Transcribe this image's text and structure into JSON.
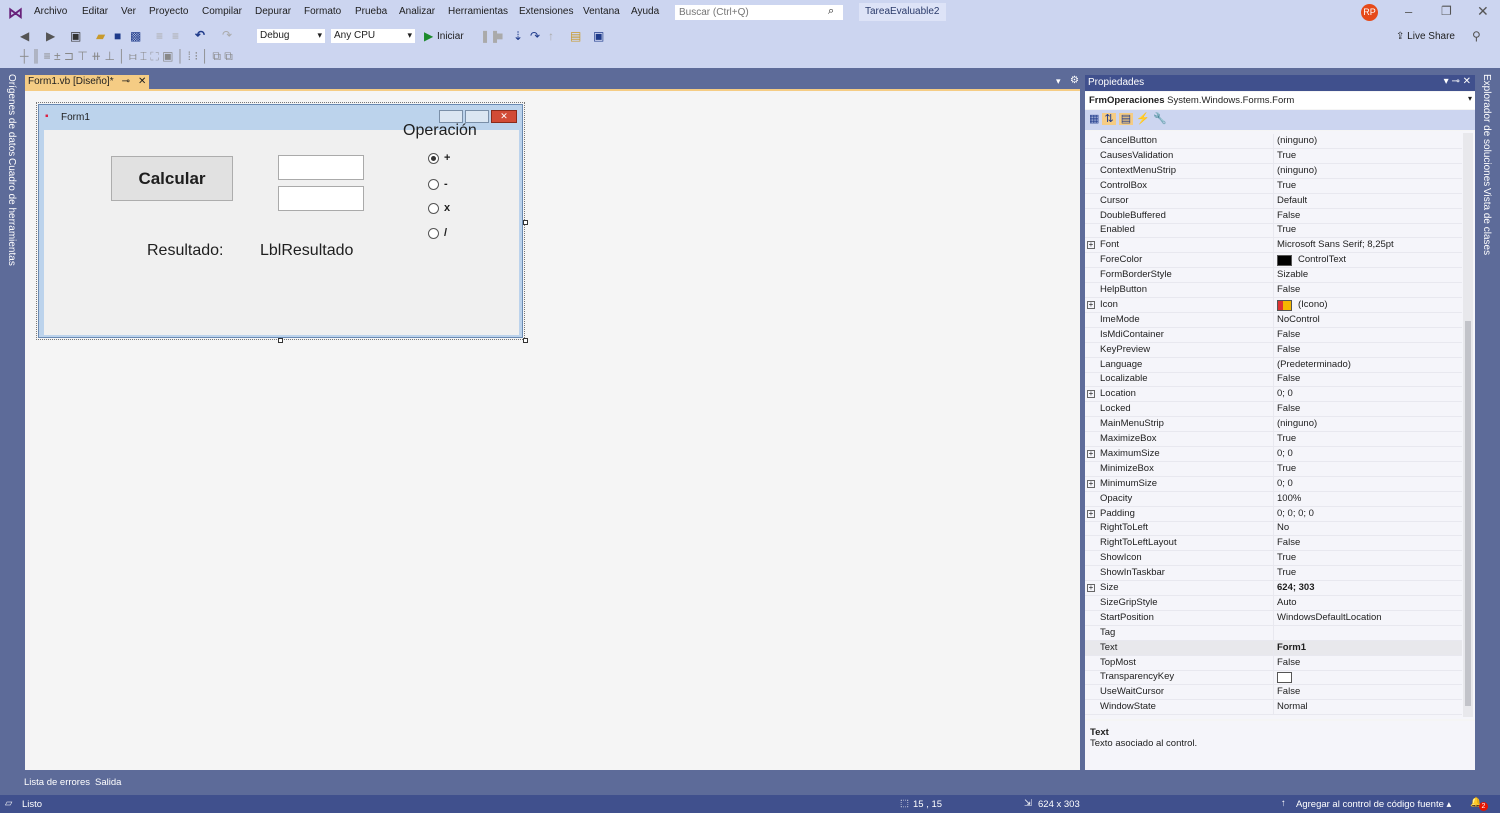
{
  "menu": [
    "Archivo",
    "Editar",
    "Ver",
    "Proyecto",
    "Compilar",
    "Depurar",
    "Formato",
    "Prueba",
    "Analizar",
    "Herramientas",
    "Extensiones",
    "Ventana",
    "Ayuda"
  ],
  "search": {
    "placeholder": "Buscar (Ctrl+Q)"
  },
  "solution_name": "TareaEvaluable2",
  "user_initials": "RP",
  "live_share": "Live Share",
  "toolbar": {
    "config": "Debug",
    "platform": "Any CPU",
    "start": "Iniciar"
  },
  "left_tabs": [
    "Orígenes de datos",
    "Cuadro de herramientas"
  ],
  "right_tabs": [
    "Explorador de soluciones",
    "Vista de clases"
  ],
  "doc_tab": "Form1.vb [Diseño]*",
  "form": {
    "title": "Form1",
    "button": "Calcular",
    "group_label": "Operación",
    "radios": [
      {
        "label": "+",
        "checked": true
      },
      {
        "label": "-",
        "checked": false
      },
      {
        "label": "x",
        "checked": false
      },
      {
        "label": "/",
        "checked": false
      }
    ],
    "result_label": "Resultado:",
    "result_value": "LblResultado"
  },
  "properties": {
    "title": "Propiedades",
    "object_name": "FrmOperaciones",
    "object_type": "System.Windows.Forms.Form",
    "rows": [
      {
        "name": "CancelButton",
        "value": "(ninguno)"
      },
      {
        "name": "CausesValidation",
        "value": "True"
      },
      {
        "name": "ContextMenuStrip",
        "value": "(ninguno)"
      },
      {
        "name": "ControlBox",
        "value": "True"
      },
      {
        "name": "Cursor",
        "value": "Default"
      },
      {
        "name": "DoubleBuffered",
        "value": "False"
      },
      {
        "name": "Enabled",
        "value": "True"
      },
      {
        "name": "Font",
        "value": "Microsoft Sans Serif; 8,25pt",
        "expand": true
      },
      {
        "name": "ForeColor",
        "value": "ControlText",
        "swatch": "#000000"
      },
      {
        "name": "FormBorderStyle",
        "value": "Sizable"
      },
      {
        "name": "HelpButton",
        "value": "False"
      },
      {
        "name": "Icon",
        "value": "(Icono)",
        "expand": true,
        "icon": true
      },
      {
        "name": "ImeMode",
        "value": "NoControl"
      },
      {
        "name": "IsMdiContainer",
        "value": "False"
      },
      {
        "name": "KeyPreview",
        "value": "False"
      },
      {
        "name": "Language",
        "value": "(Predeterminado)"
      },
      {
        "name": "Localizable",
        "value": "False"
      },
      {
        "name": "Location",
        "value": "0; 0",
        "expand": true
      },
      {
        "name": "Locked",
        "value": "False"
      },
      {
        "name": "MainMenuStrip",
        "value": "(ninguno)"
      },
      {
        "name": "MaximizeBox",
        "value": "True"
      },
      {
        "name": "MaximumSize",
        "value": "0; 0",
        "expand": true
      },
      {
        "name": "MinimizeBox",
        "value": "True"
      },
      {
        "name": "MinimumSize",
        "value": "0; 0",
        "expand": true
      },
      {
        "name": "Opacity",
        "value": "100%"
      },
      {
        "name": "Padding",
        "value": "0; 0; 0; 0",
        "expand": true
      },
      {
        "name": "RightToLeft",
        "value": "No"
      },
      {
        "name": "RightToLeftLayout",
        "value": "False"
      },
      {
        "name": "ShowIcon",
        "value": "True"
      },
      {
        "name": "ShowInTaskbar",
        "value": "True"
      },
      {
        "name": "Size",
        "value": "624; 303",
        "expand": true,
        "bold": true
      },
      {
        "name": "SizeGripStyle",
        "value": "Auto"
      },
      {
        "name": "StartPosition",
        "value": "WindowsDefaultLocation"
      },
      {
        "name": "Tag",
        "value": ""
      },
      {
        "name": "Text",
        "value": "Form1",
        "bold": true,
        "selected": true
      },
      {
        "name": "TopMost",
        "value": "False"
      },
      {
        "name": "TransparencyKey",
        "value": "",
        "swatch": "#ffffff"
      },
      {
        "name": "UseWaitCursor",
        "value": "False"
      },
      {
        "name": "WindowState",
        "value": "Normal"
      }
    ],
    "desc_title": "Text",
    "desc_text": "Texto asociado al control."
  },
  "bottom_tabs": [
    "Lista de errores",
    "Salida"
  ],
  "status": {
    "ready": "Listo",
    "position": "15 , 15",
    "size": "624 x 303",
    "source_control": "Agregar al control de código fuente",
    "notifications": "2"
  },
  "colors": {
    "accent": "#68217a",
    "frame": "#5d6b99",
    "status_bar": "#40508d",
    "tab_active": "#f5cc84",
    "avatar": "#e64a19"
  }
}
